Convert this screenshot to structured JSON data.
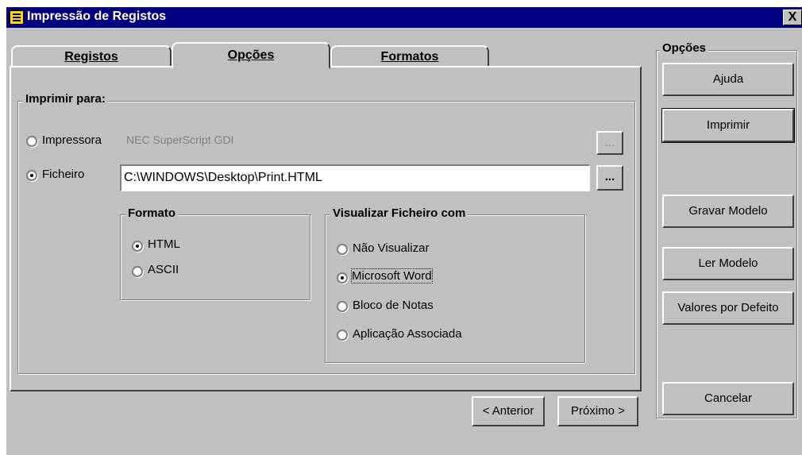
{
  "window": {
    "title": "Impressão de Registos",
    "close_glyph": "X",
    "icon": "notepad-icon"
  },
  "tabs": [
    {
      "label": "Registos",
      "active": false
    },
    {
      "label": "Opções",
      "active": true
    },
    {
      "label": "Formatos",
      "active": false
    }
  ],
  "print_to": {
    "legend": "Imprimir para:",
    "printer": {
      "label": "Impressora",
      "value": "NEC SuperScript GDI",
      "selected": false,
      "browse": "..."
    },
    "file": {
      "label": "Ficheiro",
      "value": "C:\\WINDOWS\\Desktop\\Print.HTML",
      "selected": true,
      "browse": "..."
    }
  },
  "format": {
    "legend": "Formato",
    "options": [
      {
        "label": "HTML",
        "selected": true
      },
      {
        "label": "ASCII",
        "selected": false
      }
    ]
  },
  "view_with": {
    "legend": "Visualizar Ficheiro com",
    "options": [
      {
        "label": "Não Visualizar",
        "selected": false
      },
      {
        "label": "Microsoft Word",
        "selected": true
      },
      {
        "label": "Bloco de Notas",
        "selected": false
      },
      {
        "label": "Aplicação Associada",
        "selected": false
      }
    ]
  },
  "nav": {
    "previous": "< Anterior",
    "next": "Próximo >"
  },
  "options_panel": {
    "legend": "Opções",
    "help": "Ajuda",
    "print": "Imprimir",
    "save_template": "Gravar Modelo",
    "load_template": "Ler Modelo",
    "defaults": "Valores por Defeito",
    "cancel": "Cancelar"
  }
}
